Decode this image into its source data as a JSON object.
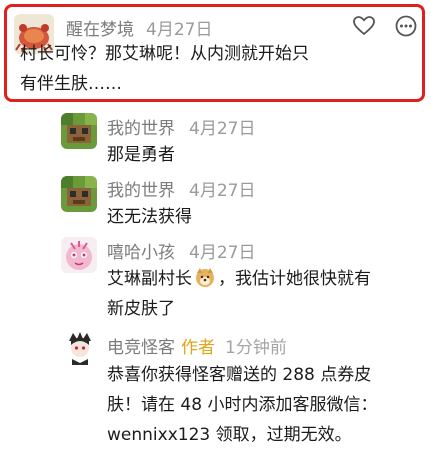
{
  "comments": [
    {
      "user": "醒在梦境",
      "date": "4月27日",
      "lines": [
        "村长可怜？那艾琳呢！从内测就开始只",
        "有伴生肤……"
      ],
      "highlight_color": "#e0201e"
    },
    {
      "user": "我的世界",
      "date": "4月27日",
      "lines": [
        "那是勇者"
      ]
    },
    {
      "user": "我的世界",
      "date": "4月27日",
      "lines": [
        "还无法获得"
      ]
    },
    {
      "user": "嘻哈小孩",
      "date": "4月27日",
      "line1_part1": "艾琳副村长",
      "line1_part2": "，我估计她很快就有",
      "line2": "新皮肤了"
    },
    {
      "user": "电竞怪客",
      "badge": "作者",
      "time_ago": "1分钟前",
      "lines": [
        "恭喜你获得怪客赠送的 288 点券皮",
        "肤！请在 48 小时内添加客服微信：",
        "wennixx123 领取，过期无效。"
      ]
    }
  ],
  "icons": {
    "like": "heart-outline-icon",
    "more": "more-dots-icon",
    "emoji": "doge-emoji-icon"
  },
  "colors": {
    "username": "#7c7c7c",
    "date": "#9a9a9a",
    "author_badge": "#e1a51a"
  }
}
